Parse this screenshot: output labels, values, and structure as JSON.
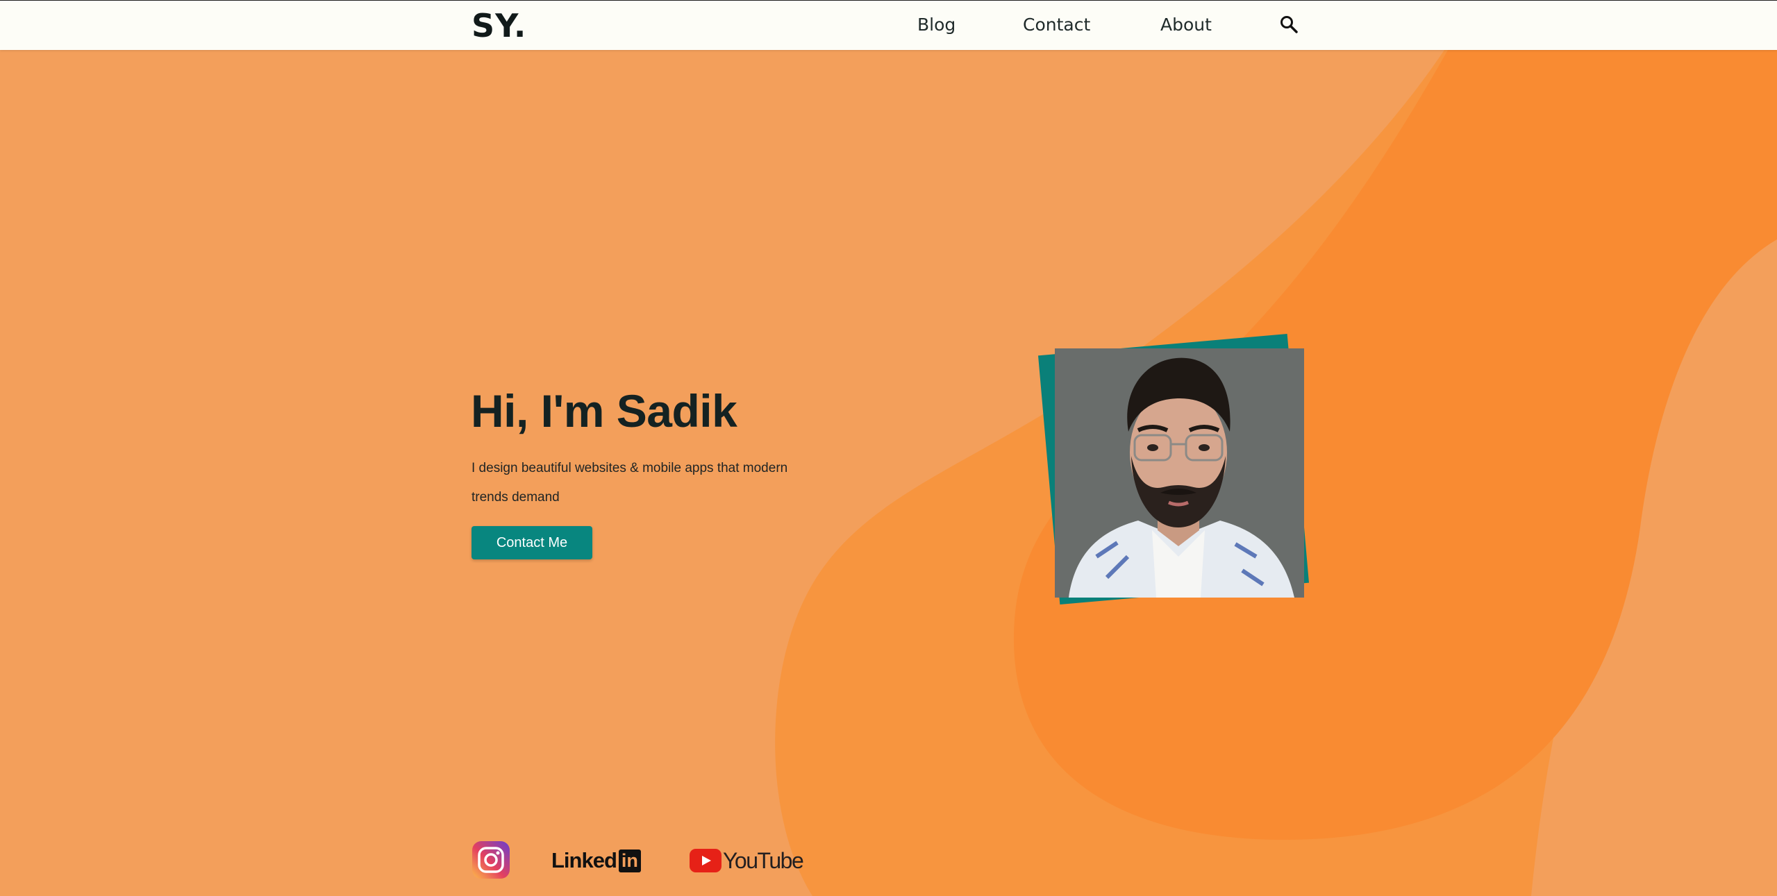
{
  "header": {
    "logo": "SY.",
    "nav": [
      {
        "label": "Blog"
      },
      {
        "label": "Contact"
      },
      {
        "label": "About"
      }
    ],
    "search_icon": "search-icon"
  },
  "hero": {
    "title": "Hi, I'm Sadik",
    "description": "I design beautiful websites & mobile apps that modern trends demand",
    "cta_label": "Contact Me",
    "photo": "portrait-photo"
  },
  "social": [
    {
      "name": "instagram",
      "icon": "instagram-icon"
    },
    {
      "name": "linkedin",
      "label": "Linked",
      "badge": "in",
      "icon": "linkedin-logo"
    },
    {
      "name": "youtube",
      "label": "YouTube",
      "icon": "youtube-logo"
    }
  ],
  "colors": {
    "page_bg": "#f39f5b",
    "blob": "#f98b32",
    "accent": "#08867f",
    "header_bg": "#fdfdf7",
    "text_dark": "#142222"
  }
}
